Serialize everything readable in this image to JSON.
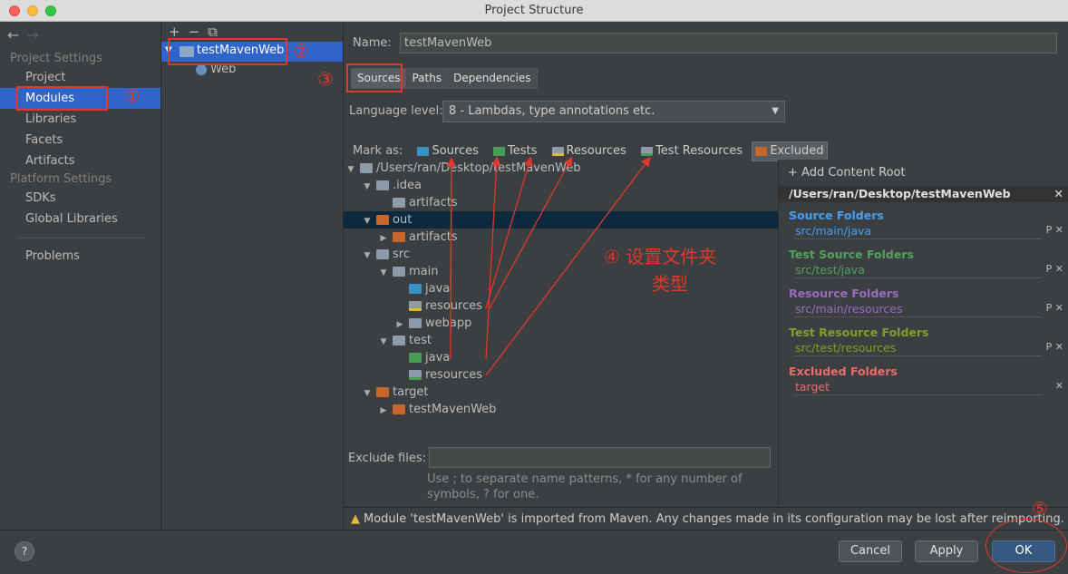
{
  "window": {
    "title": "Project Structure"
  },
  "left_nav": {
    "section_project": "Project Settings",
    "items_project": [
      "Project",
      "Modules",
      "Libraries",
      "Facets",
      "Artifacts"
    ],
    "section_platform": "Platform Settings",
    "items_platform": [
      "SDKs",
      "Global Libraries"
    ],
    "problems": "Problems",
    "back_glyph": "←",
    "forward_glyph": "→"
  },
  "modules": {
    "toolbar": [
      "+",
      "−",
      "⧉"
    ],
    "module_name": "testMavenWeb",
    "facet": "Web"
  },
  "detail": {
    "name_label": "Name:",
    "name_value": "testMavenWeb",
    "tabs": [
      "Sources",
      "Paths",
      "Dependencies"
    ],
    "language_level_label": "Language level:",
    "language_level_value": "8 - Lambdas, type annotations etc.",
    "mark_as_label": "Mark as:",
    "mark_as": [
      "Sources",
      "Tests",
      "Resources",
      "Test Resources",
      "Excluded"
    ],
    "tree": [
      "/Users/ran/Desktop/testMavenWeb",
      ".idea",
      "artifacts",
      "out",
      "artifacts",
      "src",
      "main",
      "java",
      "resources",
      "webapp",
      "test",
      "java",
      "resources",
      "target",
      "testMavenWeb"
    ],
    "exclude_label": "Exclude files:",
    "exclude_hint": "Use ; to separate name patterns, * for any number of symbols, ? for one.",
    "warning": "Module 'testMavenWeb' is imported from Maven. Any changes made in its configuration may be lost after reimporting."
  },
  "content_root": {
    "add_label": "+ Add Content Root",
    "path": "/Users/ran/Desktop/testMavenWeb",
    "groups": [
      {
        "title": "Source Folders",
        "item": "src/main/java",
        "color": "#4a9eed"
      },
      {
        "title": "Test Source Folders",
        "item": "src/test/java",
        "color": "#50a35b"
      },
      {
        "title": "Resource Folders",
        "item": "src/main/resources",
        "color": "#9a6bc0"
      },
      {
        "title": "Test Resource Folders",
        "item": "src/test/resources",
        "color": "#7f9f28"
      },
      {
        "title": "Excluded Folders",
        "item": "target",
        "color": "#e86c6c"
      }
    ]
  },
  "buttons": {
    "help": "?",
    "cancel": "Cancel",
    "apply": "Apply",
    "ok": "OK"
  },
  "annotations": {
    "n1": "①",
    "n2": "②",
    "n3": "③",
    "n4_line1": "④ 设置文件夹",
    "n4_line2": "类型",
    "n5": "⑤"
  },
  "colors": {
    "selection": "#2f65ca",
    "annotation": "#e0382c",
    "source_folder": "#3592c4",
    "test_folder": "#499c54",
    "excluded_folder": "#c9662c",
    "plain_folder": "#8c9aaa"
  }
}
